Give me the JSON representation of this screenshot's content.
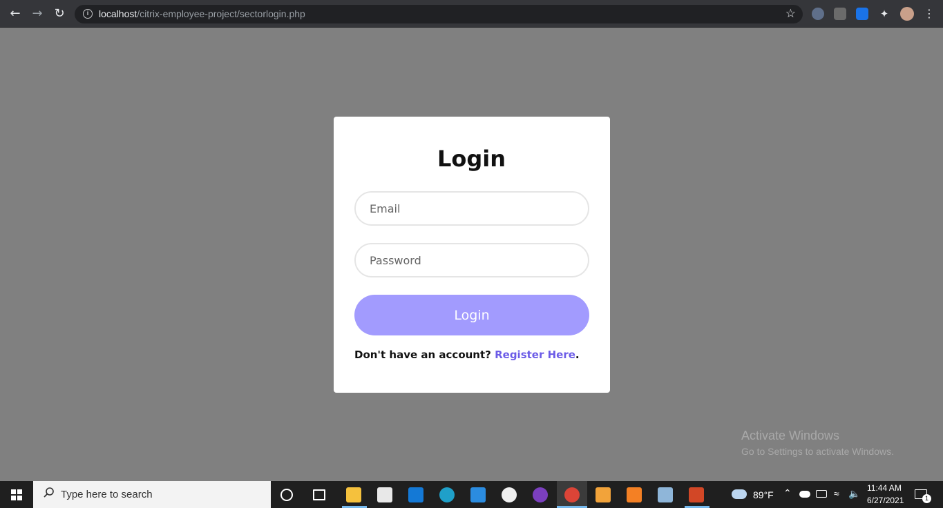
{
  "browser": {
    "url_host": "localhost",
    "url_path": "/citrix-employee-project/sectorlogin.php"
  },
  "login": {
    "title": "Login",
    "email_placeholder": "Email",
    "password_placeholder": "Password",
    "button_label": "Login",
    "register_prompt": "Don't have an account?",
    "register_link": "Register Here",
    "register_suffix": "."
  },
  "watermark": {
    "title": "Activate Windows",
    "subtitle": "Go to Settings to activate Windows."
  },
  "taskbar": {
    "search_placeholder": "Type here to search",
    "weather": "89°F",
    "time": "11:44 AM",
    "date": "6/27/2021",
    "notification_count": "1"
  },
  "colors": {
    "accent": "#a29bfe",
    "link": "#6c5ce7",
    "page_background": "#808080"
  }
}
